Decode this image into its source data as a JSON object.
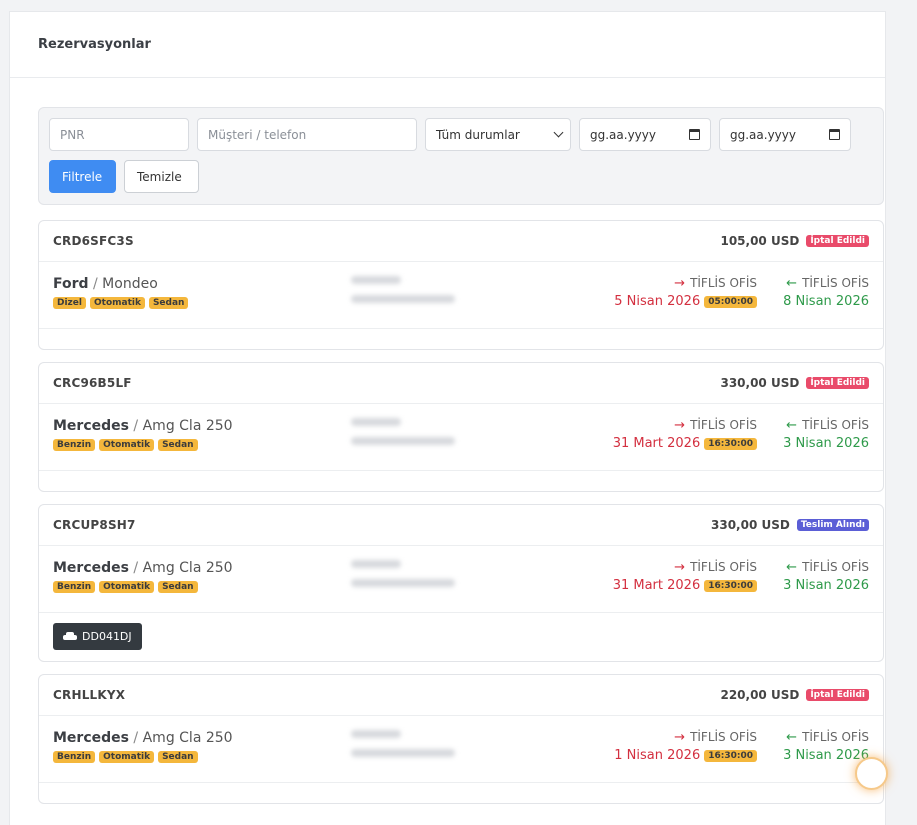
{
  "page": {
    "title": "Rezervasyonlar"
  },
  "filters": {
    "pnr_placeholder": "PNR",
    "customer_placeholder": "Müşteri / telefon",
    "status_selected": "Tüm durumlar",
    "date_from_placeholder": "gg.aa.yyyy",
    "date_to_placeholder": "gg.aa.yyyy",
    "filter_label": "Filtrele",
    "clear_label": "Temizle"
  },
  "colors": {
    "cancelled": "#e94b6a",
    "delivered": "#5b5ed6",
    "primary": "#3f8cf2"
  },
  "reservations": [
    {
      "pnr": "CRD6SFC3S",
      "price": "105,00 USD",
      "status": "İptal Edildi",
      "brand": "Ford",
      "model": "Mondeo",
      "tags": [
        "Dizel",
        "Otomatik",
        "Sedan"
      ],
      "pickup_location": "TİFLİS OFİS",
      "pickup_date": "5 Nisan 2026",
      "pickup_time": "05:00:00",
      "dropoff_location": "TİFLİS OFİS",
      "dropoff_date": "8 Nisan 2026"
    },
    {
      "pnr": "CRC96B5LF",
      "price": "330,00 USD",
      "status": "İptal Edildi",
      "brand": "Mercedes",
      "model": "Amg Cla 250",
      "tags": [
        "Benzin",
        "Otomatik",
        "Sedan"
      ],
      "pickup_location": "TİFLİS OFİS",
      "pickup_date": "31 Mart 2026",
      "pickup_time": "16:30:00",
      "dropoff_location": "TİFLİS OFİS",
      "dropoff_date": "3 Nisan 2026"
    },
    {
      "pnr": "CRCUP8SH7",
      "price": "330,00 USD",
      "status": "Teslim Alındı",
      "brand": "Mercedes",
      "model": "Amg Cla 250",
      "tags": [
        "Benzin",
        "Otomatik",
        "Sedan"
      ],
      "pickup_location": "TİFLİS OFİS",
      "pickup_date": "31 Mart 2026",
      "pickup_time": "16:30:00",
      "dropoff_location": "TİFLİS OFİS",
      "dropoff_date": "3 Nisan 2026",
      "plate": "DD041DJ"
    },
    {
      "pnr": "CRHLLKYX",
      "price": "220,00 USD",
      "status": "İptal Edildi",
      "brand": "Mercedes",
      "model": "Amg Cla 250",
      "tags": [
        "Benzin",
        "Otomatik",
        "Sedan"
      ],
      "pickup_location": "TİFLİS OFİS",
      "pickup_date": "1 Nisan 2026",
      "pickup_time": "16:30:00",
      "dropoff_location": "TİFLİS OFİS",
      "dropoff_date": "3 Nisan 2026"
    }
  ]
}
